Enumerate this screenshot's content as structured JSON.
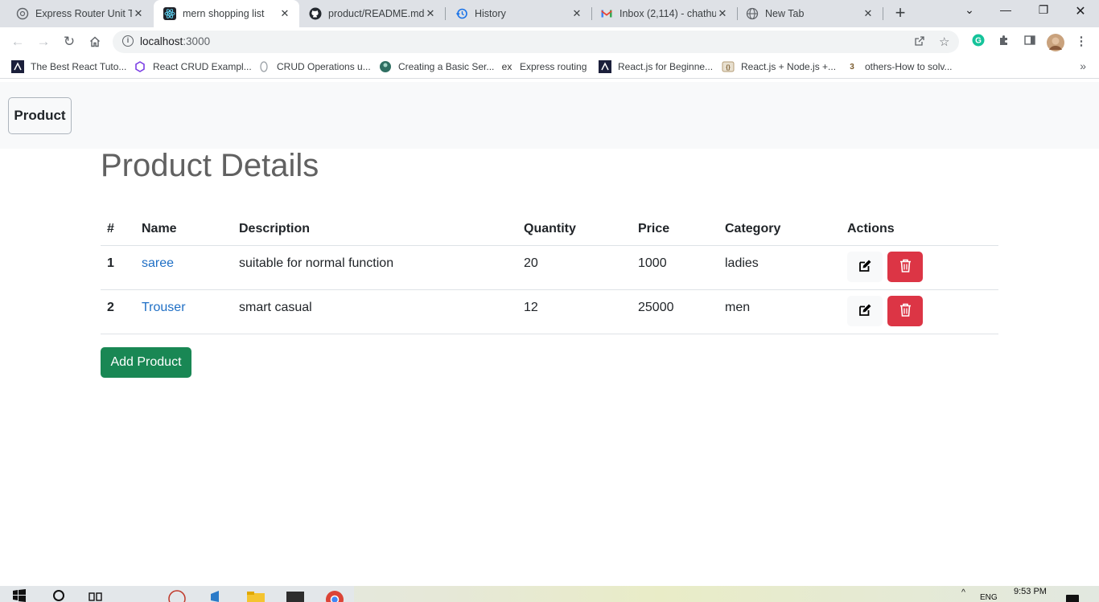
{
  "browser": {
    "tabs": [
      {
        "title": "Express Router Unit Te",
        "icon": "chatgpt-icon"
      },
      {
        "title": "mern shopping list",
        "icon": "react-icon",
        "active": true
      },
      {
        "title": "product/README.md",
        "icon": "github-icon"
      },
      {
        "title": "History",
        "icon": "history-icon"
      },
      {
        "title": "Inbox (2,114) - chathu",
        "icon": "gmail-icon"
      },
      {
        "title": "New Tab",
        "icon": "globe-icon"
      }
    ],
    "url_host": "localhost",
    "url_port": ":3000",
    "bookmarks": [
      "The Best React Tuto...",
      "React CRUD Exampl...",
      "CRUD Operations u...",
      "Creating a Basic Ser...",
      "Express routing",
      "React.js for Beginne...",
      "React.js + Node.js +...",
      "others-How to solv..."
    ]
  },
  "navbar": {
    "brand": "Product"
  },
  "main": {
    "heading": "Product Details",
    "table": {
      "headers": [
        "#",
        "Name",
        "Description",
        "Quantity",
        "Price",
        "Category",
        "Actions"
      ],
      "rows": [
        {
          "index": "1",
          "name": "saree",
          "description": "suitable for normal function",
          "quantity": "20",
          "price": "1000",
          "category": "ladies"
        },
        {
          "index": "2",
          "name": "Trouser",
          "description": "smart casual",
          "quantity": "12",
          "price": "25000",
          "category": "men"
        }
      ]
    },
    "add_button": "Add Product"
  },
  "taskbar": {
    "time": "9:53 PM",
    "lang": "ENG"
  },
  "colors": {
    "edit_bg": "#f8f9fa",
    "delete_bg": "#dc3545",
    "add_bg": "#198754",
    "link": "#1f6fc5"
  }
}
